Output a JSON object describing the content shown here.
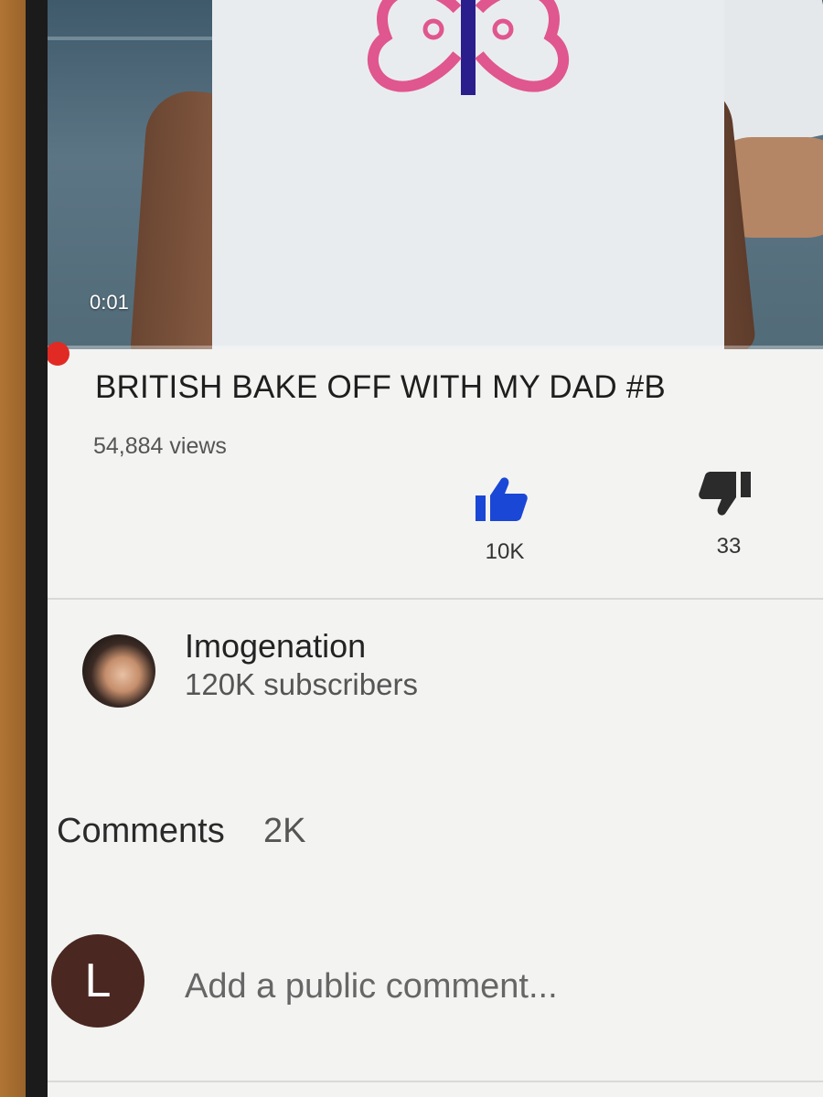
{
  "video": {
    "timestamp": "0:01",
    "progress_fraction": 0.0
  },
  "title": "BRITISH BAKE OFF WITH MY DAD #B",
  "views": "54,884 views",
  "actions": {
    "like_count": "10K",
    "dislike_count": "33",
    "like_icon": "thumbs-up-icon",
    "dislike_icon": "thumbs-down-icon",
    "like_color": "#1a47d6"
  },
  "channel": {
    "name": "Imogenation",
    "subscribers": "120K subscribers"
  },
  "comments": {
    "label": "Comments",
    "count": "2K",
    "user_initial": "L",
    "placeholder": "Add a public comment..."
  },
  "colors": {
    "progress_dot": "#e12a24",
    "user_avatar_bg": "#4a2720"
  }
}
